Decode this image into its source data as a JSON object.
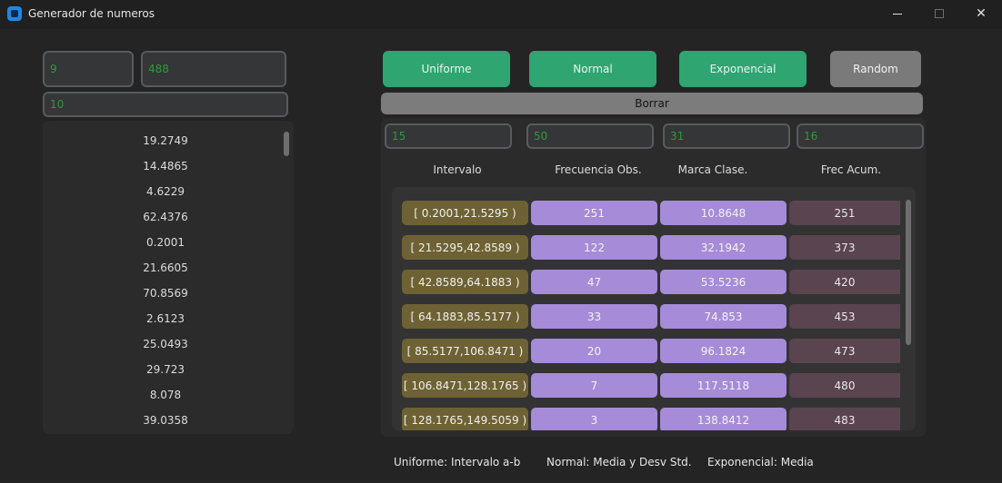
{
  "window": {
    "title": "Generador de numeros",
    "icons": {
      "app": "app-icon",
      "minimize": "minimize-icon",
      "maximize": "maximize-icon",
      "close": "close-icon"
    }
  },
  "inputs": {
    "param_a": "9",
    "param_b": "488",
    "cantidad": "10"
  },
  "generated_numbers": [
    "19.2749",
    "14.4865",
    "4.6229",
    "62.4376",
    "0.2001",
    "21.6605",
    "70.8569",
    "2.6123",
    "25.0493",
    "29.723",
    "8.078",
    "39.0358"
  ],
  "buttons": {
    "uniforme": "Uniforme",
    "normal": "Normal",
    "exponencial": "Exponencial",
    "random": "Random",
    "borrar": "Borrar"
  },
  "table_inputs": {
    "intervalos": "15",
    "v2": "50",
    "v3": "31",
    "v4": "16"
  },
  "table": {
    "headers": [
      "Intervalo",
      "Frecuencia Obs.",
      "Marca Clase.",
      "Frec Acum."
    ],
    "rows": [
      {
        "intervalo": "[ 0.2001,21.5295 )",
        "obs": "251",
        "marca": "10.8648",
        "acum": "251"
      },
      {
        "intervalo": "[ 21.5295,42.8589 )",
        "obs": "122",
        "marca": "32.1942",
        "acum": "373"
      },
      {
        "intervalo": "[ 42.8589,64.1883 )",
        "obs": "47",
        "marca": "53.5236",
        "acum": "420"
      },
      {
        "intervalo": "[ 64.1883,85.5177 )",
        "obs": "33",
        "marca": "74.853",
        "acum": "453"
      },
      {
        "intervalo": "[ 85.5177,106.8471 )",
        "obs": "20",
        "marca": "96.1824",
        "acum": "473"
      },
      {
        "intervalo": "[ 106.8471,128.1765 )",
        "obs": "7",
        "marca": "117.5118",
        "acum": "480"
      },
      {
        "intervalo": "[ 128.1765,149.5059 )",
        "obs": "3",
        "marca": "138.8412",
        "acum": "483"
      }
    ]
  },
  "footer": {
    "uniforme": "Uniforme: Intervalo a-b",
    "normal": "Normal: Media y Desv Std.",
    "exponencial": "Exponencial: Media"
  },
  "colors": {
    "accent_green": "#2fa572",
    "entry_text": "#2e9a3a",
    "interval_cell": "#6e6234",
    "freq_cell": "#a68bd8",
    "acum_cell": "#5a4450"
  }
}
